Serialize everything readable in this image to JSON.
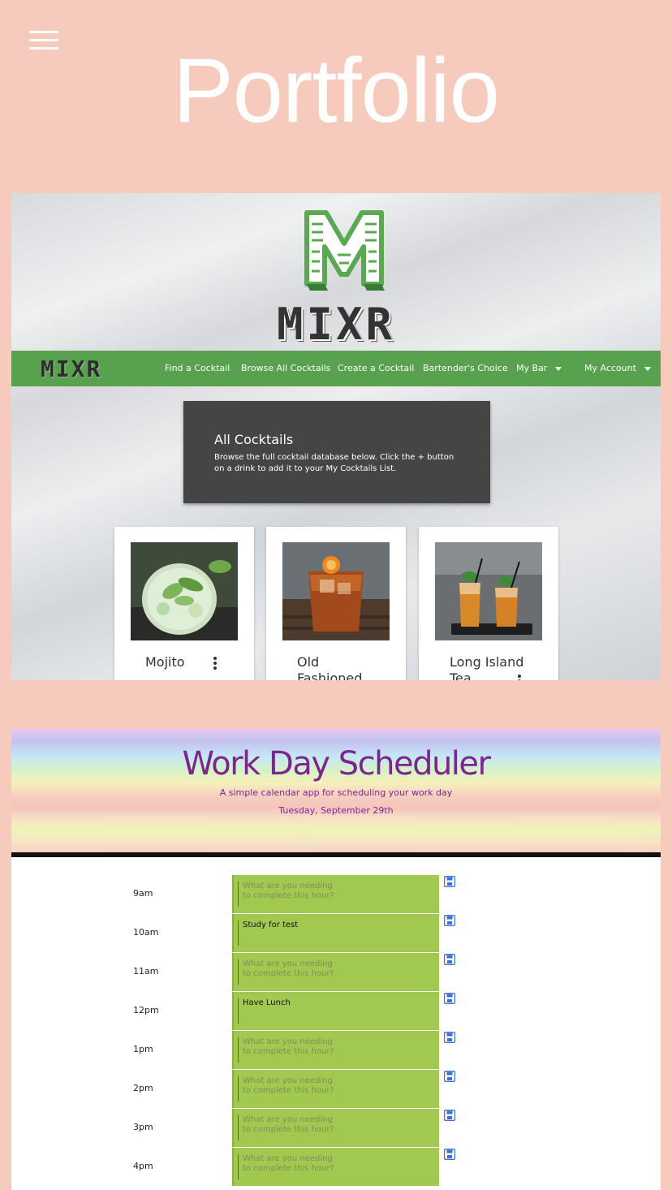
{
  "page": {
    "title": "Portfolio"
  },
  "menu": {
    "icon": "hamburger-menu-icon"
  },
  "colors": {
    "background": "#f7cabe",
    "mixr_green": "#58a14f",
    "scheduler_purple": "#7b2590",
    "task_green": "#a1c94f"
  },
  "mixr": {
    "logo_text": "MIXR",
    "nav": {
      "brand": "MIXR",
      "links": [
        "Find a Cocktail",
        "Browse All Cocktails",
        "Create a Cocktail",
        "Bartender's Choice",
        "My Bar",
        "My Account"
      ]
    },
    "hero": {
      "heading": "All Cocktails",
      "text": "Browse the full cocktail database below. Click the + button on a drink to add it to your My Cocktails List."
    },
    "cards": [
      {
        "name": "Mojito"
      },
      {
        "name": "Old Fashioned"
      },
      {
        "name": "Long Island Tea"
      }
    ]
  },
  "scheduler": {
    "title": "Work Day Scheduler",
    "subtitle": "A simple calendar app for scheduling your work day",
    "date": "Tuesday, September 29th",
    "placeholder": "What are you needing\nto complete this hour?",
    "rows": [
      {
        "hour": "9am",
        "task": ""
      },
      {
        "hour": "10am",
        "task": "Study for test"
      },
      {
        "hour": "11am",
        "task": ""
      },
      {
        "hour": "12pm",
        "task": "Have Lunch"
      },
      {
        "hour": "1pm",
        "task": ""
      },
      {
        "hour": "2pm",
        "task": ""
      },
      {
        "hour": "3pm",
        "task": ""
      },
      {
        "hour": "4pm",
        "task": ""
      }
    ]
  }
}
